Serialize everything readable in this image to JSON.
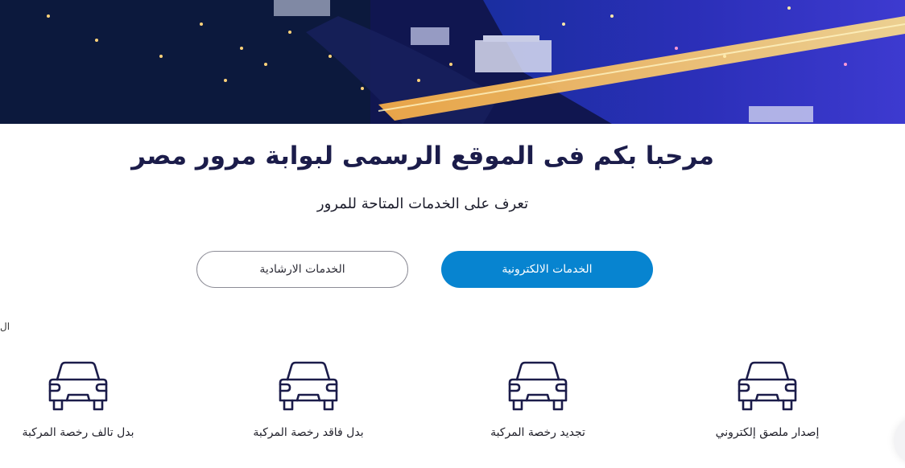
{
  "hero": {
    "image": "night-city-river-bridge-banner"
  },
  "welcome": {
    "title": "مرحبا بكم فى الموقع الرسمى لبوابة مرور مصر",
    "subtitle": "تعرف على الخدمات المتاحة للمرور"
  },
  "tabs": [
    {
      "label": "الخدمات الالكترونية",
      "active": true
    },
    {
      "label": "الخدمات الارشادية",
      "active": false
    }
  ],
  "edge_text": "ال",
  "services": [
    {
      "label": "إصدار ملصق إلكتروني",
      "icon": "car-icon"
    },
    {
      "label": "تجديد رخصة المركبة",
      "icon": "car-icon"
    },
    {
      "label": "بدل فاقد رخصة المركبة",
      "icon": "car-icon"
    },
    {
      "label": "بدل تالف رخصة المركبة",
      "icon": "car-icon"
    }
  ],
  "colors": {
    "primary": "#0784d0",
    "heading": "#1b1c4a",
    "icon_stroke": "#1b1c4a"
  }
}
